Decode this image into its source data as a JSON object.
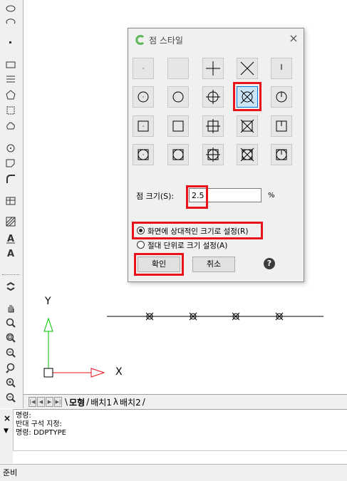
{
  "dialog": {
    "title": "점 스타일",
    "size_label": "점 크기(S):",
    "size_value": "2.5",
    "size_unit": "%",
    "radio_relative": "화면에 상대적인 크기로 설정(R)",
    "radio_absolute": "절대 단위로 크기 설정(A)",
    "selected_radio": "relative",
    "ok_label": "확인",
    "cancel_label": "취소",
    "help_symbol": "?",
    "selected_style": "circle-x",
    "styles": [
      "dot",
      "none",
      "plus",
      "x",
      "tick",
      "circle-dot",
      "circle",
      "circle-plus",
      "circle-x",
      "circle-tick",
      "square-dot",
      "square",
      "square-plus",
      "square-x",
      "square-tick",
      "circle-square-dot",
      "circle-square",
      "circle-square-plus",
      "circle-square-x",
      "circle-square-tick"
    ]
  },
  "canvas": {
    "y_axis_label": "Y",
    "x_axis_label": "X",
    "point_count": 4
  },
  "tabs": {
    "model": "모형",
    "layout1": "배치1",
    "layout2": "배치2"
  },
  "command": {
    "lines": [
      "명령:",
      "반대 구석 지정:",
      "명령: DDPTYPE"
    ]
  },
  "status": {
    "text": "준비"
  },
  "colors": {
    "highlight": "#e8141c",
    "selection": "#cce4f7",
    "accent": "#0078d7",
    "ucs_y": "#00c000",
    "ucs_x": "#e8141c"
  }
}
